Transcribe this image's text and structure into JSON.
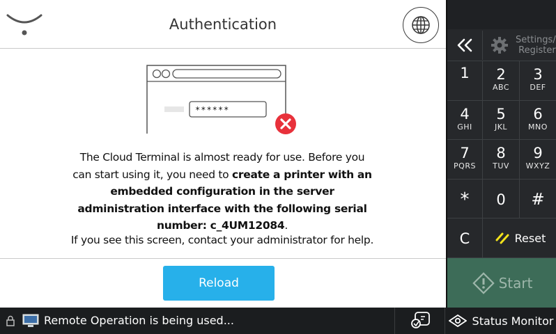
{
  "header": {
    "title": "Authentication"
  },
  "illustration": {
    "password_mask": "******"
  },
  "message": {
    "part1": "The Cloud Terminal is almost ready for use. Before you can start using it, you need to ",
    "part2_bold": "create a printer with an embedded configuration in the server administration interface with the following serial number: c_4UM12084",
    "part3": ".",
    "help": "If you see this screen, contact your administrator for help."
  },
  "buttons": {
    "reload": "Reload"
  },
  "side_panel": {
    "settings_label_line1": "Settings/",
    "settings_label_line2": "Register",
    "keys": [
      {
        "digit": "1",
        "letters": ""
      },
      {
        "digit": "2",
        "letters": "ABC"
      },
      {
        "digit": "3",
        "letters": "DEF"
      },
      {
        "digit": "4",
        "letters": "GHI"
      },
      {
        "digit": "5",
        "letters": "JKL"
      },
      {
        "digit": "6",
        "letters": "MNO"
      },
      {
        "digit": "7",
        "letters": "PQRS"
      },
      {
        "digit": "8",
        "letters": "TUV"
      },
      {
        "digit": "9",
        "letters": "WXYZ"
      },
      {
        "digit": "*",
        "letters": ""
      },
      {
        "digit": "0",
        "letters": ""
      },
      {
        "digit": "#",
        "letters": ""
      }
    ],
    "clear": "C",
    "reset": "Reset",
    "start": "Start"
  },
  "status_bar": {
    "remote_text": "Remote Operation is being used...",
    "status_monitor": "Status Monitor"
  },
  "colors": {
    "accent": "#27b0ea",
    "start": "#3d6c58",
    "error": "#e8313b",
    "reset_icon": "#f2e21b"
  }
}
